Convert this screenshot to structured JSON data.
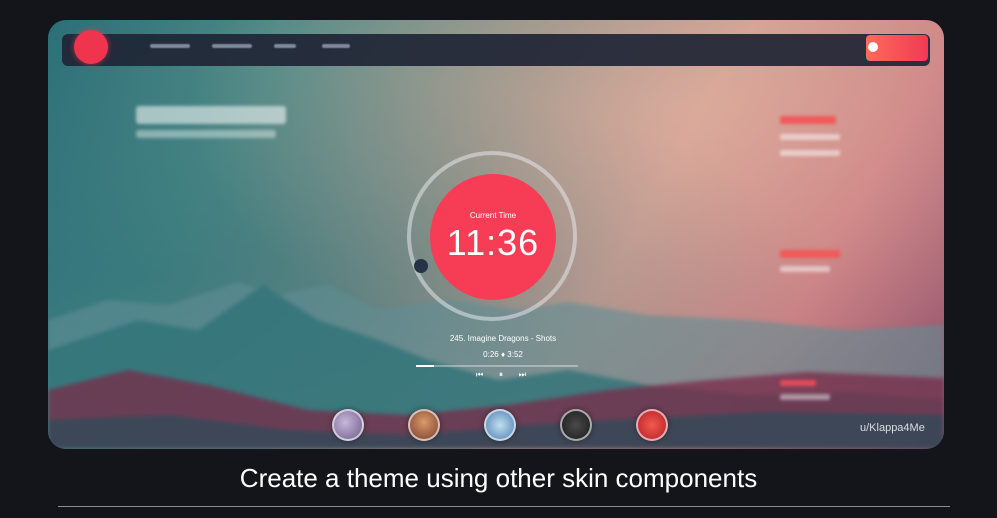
{
  "clock": {
    "label": "Current Time",
    "time": "11:36"
  },
  "track": {
    "title": "245. Imagine Dragons - Shots",
    "elapsed": "0:26",
    "separator": "♦",
    "duration": "3:52",
    "progress": 0.11
  },
  "controls": {
    "prev": "⏮",
    "pause": "⏸",
    "next": "⏭"
  },
  "watermark": "u/Klappa4Me",
  "caption": "Create a theme using other skin components"
}
